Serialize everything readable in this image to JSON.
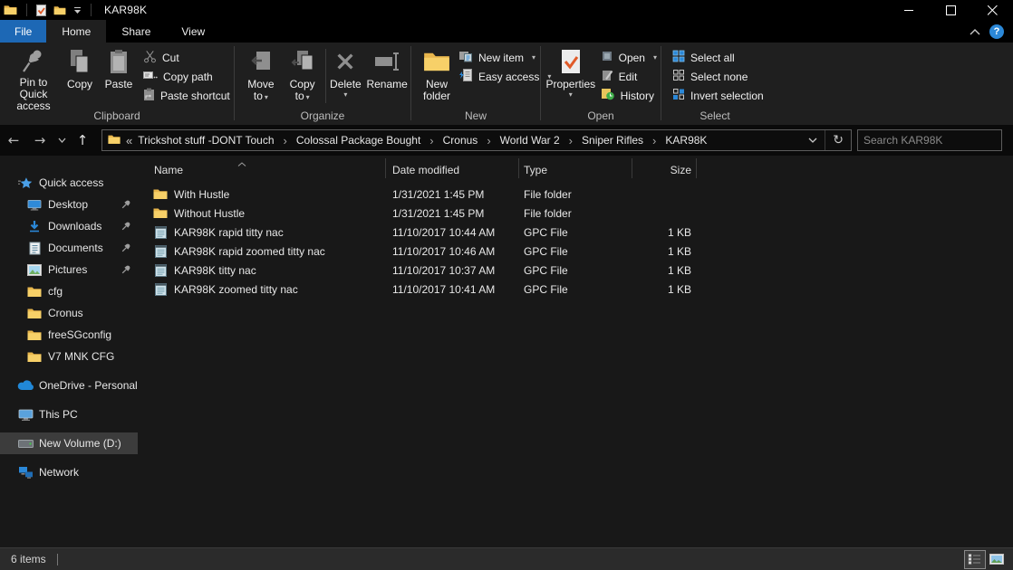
{
  "colors": {
    "accent_blue": "#1d68b5",
    "help_blue": "#2b88d8",
    "folder_yellow": "#f7d068",
    "ribbon_bg": "#1f1f1f",
    "titlebar_bg": "#000000",
    "content_bg": "#181818",
    "statusbar_bg": "#2b2b2b",
    "selection_gray": "#3c3c3c"
  },
  "icons": {
    "back": "←",
    "forward": "→",
    "up": "↑",
    "dropdown": "▾",
    "refresh": "↻",
    "root_collapse": "«",
    "crumb_separator": "›",
    "help": "?",
    "minimize": "–"
  },
  "titlebar": {
    "title": "KAR98K"
  },
  "tabs": {
    "file": "File",
    "home": "Home",
    "share": "Share",
    "view": "View"
  },
  "ribbon": {
    "clipboard": {
      "label": "Clipboard",
      "pin": "Pin to Quick access",
      "copy": "Copy",
      "paste": "Paste",
      "cut": "Cut",
      "copy_path": "Copy path",
      "paste_shortcut": "Paste shortcut"
    },
    "organize": {
      "label": "Organize",
      "move_to": "Move to",
      "copy_to": "Copy to",
      "delete": "Delete",
      "rename": "Rename"
    },
    "new": {
      "label": "New",
      "new_folder": "New folder",
      "new_item": "New item",
      "easy_access": "Easy access"
    },
    "open": {
      "label": "Open",
      "properties": "Properties",
      "open": "Open",
      "edit": "Edit",
      "history": "History"
    },
    "select": {
      "label": "Select",
      "select_all": "Select all",
      "select_none": "Select none",
      "invert_selection": "Invert selection"
    }
  },
  "navbar": {
    "breadcrumb": [
      "Trickshot stuff -DONT Touch",
      "Colossal Package Bought",
      "Cronus",
      "World War 2",
      "Sniper Rifles",
      "KAR98K"
    ],
    "search_placeholder": "Search KAR98K"
  },
  "sidebar": {
    "items": [
      {
        "label": "Quick access"
      },
      {
        "label": "Desktop"
      },
      {
        "label": "Downloads"
      },
      {
        "label": "Documents"
      },
      {
        "label": "Pictures"
      },
      {
        "label": "cfg"
      },
      {
        "label": "Cronus"
      },
      {
        "label": "freeSGconfig"
      },
      {
        "label": "V7 MNK CFG"
      },
      {
        "label": "OneDrive - Personal"
      },
      {
        "label": "This PC"
      },
      {
        "label": "New Volume (D:)"
      },
      {
        "label": "Network"
      }
    ]
  },
  "filelist": {
    "columns": [
      "Name",
      "Date modified",
      "Type",
      "Size"
    ],
    "rows": [
      {
        "name": "With Hustle",
        "date": "1/31/2021 1:45 PM",
        "type": "File folder",
        "size": ""
      },
      {
        "name": "Without Hustle",
        "date": "1/31/2021 1:45 PM",
        "type": "File folder",
        "size": ""
      },
      {
        "name": "KAR98K rapid titty nac",
        "date": "11/10/2017 10:44 AM",
        "type": "GPC File",
        "size": "1 KB"
      },
      {
        "name": "KAR98K rapid zoomed titty nac",
        "date": "11/10/2017 10:46 AM",
        "type": "GPC File",
        "size": "1 KB"
      },
      {
        "name": "KAR98K titty nac",
        "date": "11/10/2017 10:37 AM",
        "type": "GPC File",
        "size": "1 KB"
      },
      {
        "name": "KAR98K zoomed titty nac",
        "date": "11/10/2017 10:41 AM",
        "type": "GPC File",
        "size": "1 KB"
      }
    ]
  },
  "statusbar": {
    "item_count": "6 items"
  }
}
